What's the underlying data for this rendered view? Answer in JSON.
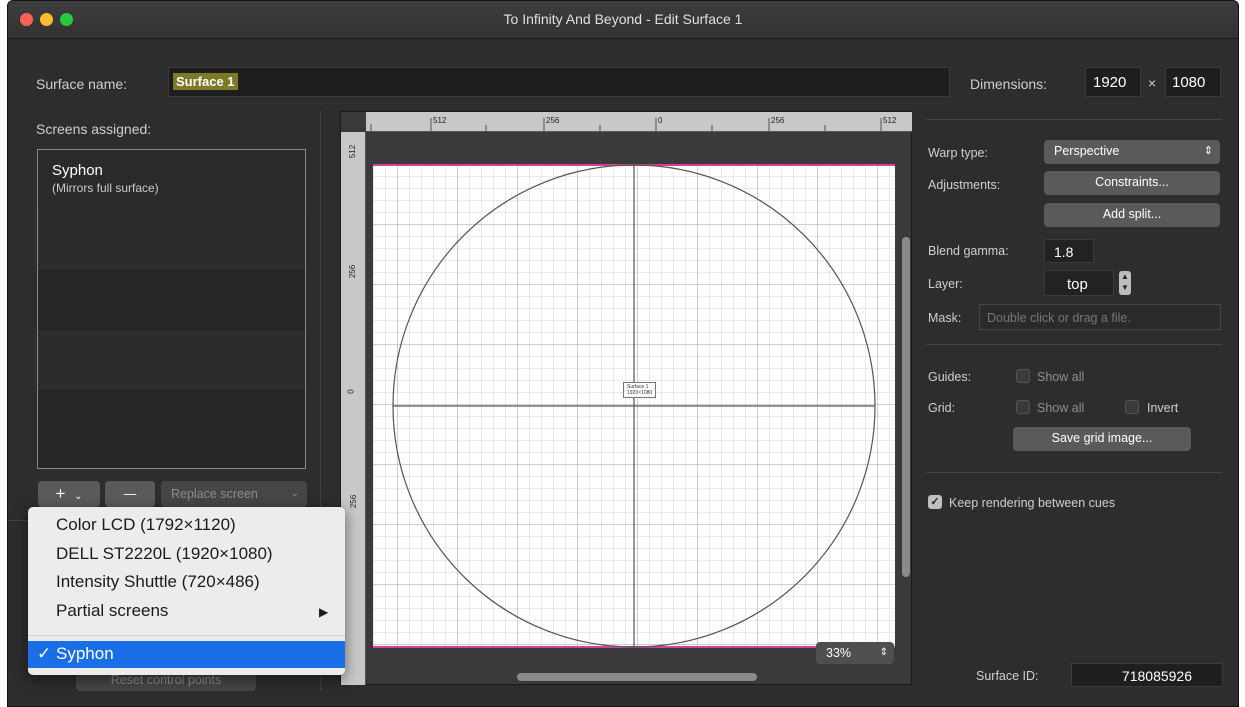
{
  "window": {
    "title": "To Infinity And Beyond - Edit Surface 1"
  },
  "surface": {
    "name_label": "Surface name:",
    "name_value": "Surface 1",
    "dimensions_label": "Dimensions:",
    "width": "1920",
    "times": "×",
    "height": "1080"
  },
  "screens": {
    "label": "Screens assigned:",
    "items": [
      {
        "name": "Syphon",
        "note": "(Mirrors full surface)"
      }
    ],
    "add_label": "+",
    "remove_label": "—",
    "replace_label": "Replace screen",
    "reset_label": "Reset control points"
  },
  "menu": {
    "items": [
      "Color LCD (1792×1120)",
      "DELL ST2220L (1920×1080)",
      "Intensity Shuttle (720×486)",
      "Partial screens"
    ],
    "submenu_arrow": "▶",
    "selected": "Syphon",
    "check": "✓"
  },
  "canvas": {
    "ruler_top": [
      "512",
      "256",
      "0",
      "256",
      "512"
    ],
    "ruler_left": [
      "512",
      "256",
      "0",
      "256"
    ],
    "center_label": "Surface 1",
    "center_sub": "1920×1080",
    "zoom": "33%"
  },
  "props": {
    "warp_label": "Warp type:",
    "warp_value": "Perspective",
    "adjust_label": "Adjustments:",
    "constraints_label": "Constraints...",
    "add_split_label": "Add split...",
    "blend_label": "Blend gamma:",
    "blend_value": "1.8",
    "layer_label": "Layer:",
    "layer_value": "top",
    "mask_label": "Mask:",
    "mask_placeholder": "Double click or drag a file.",
    "guides_label": "Guides:",
    "guides_show_all": "Show all",
    "grid_label": "Grid:",
    "grid_show_all": "Show all",
    "grid_invert": "Invert",
    "save_grid_label": "Save grid image...",
    "keep_rendering_label": "Keep rendering between cues",
    "keep_rendering_checked": true,
    "surface_id_label": "Surface ID:",
    "surface_id_value": "718085926"
  },
  "colors": {
    "accent": "#1a6fe6",
    "guide": "#d43f9a"
  }
}
